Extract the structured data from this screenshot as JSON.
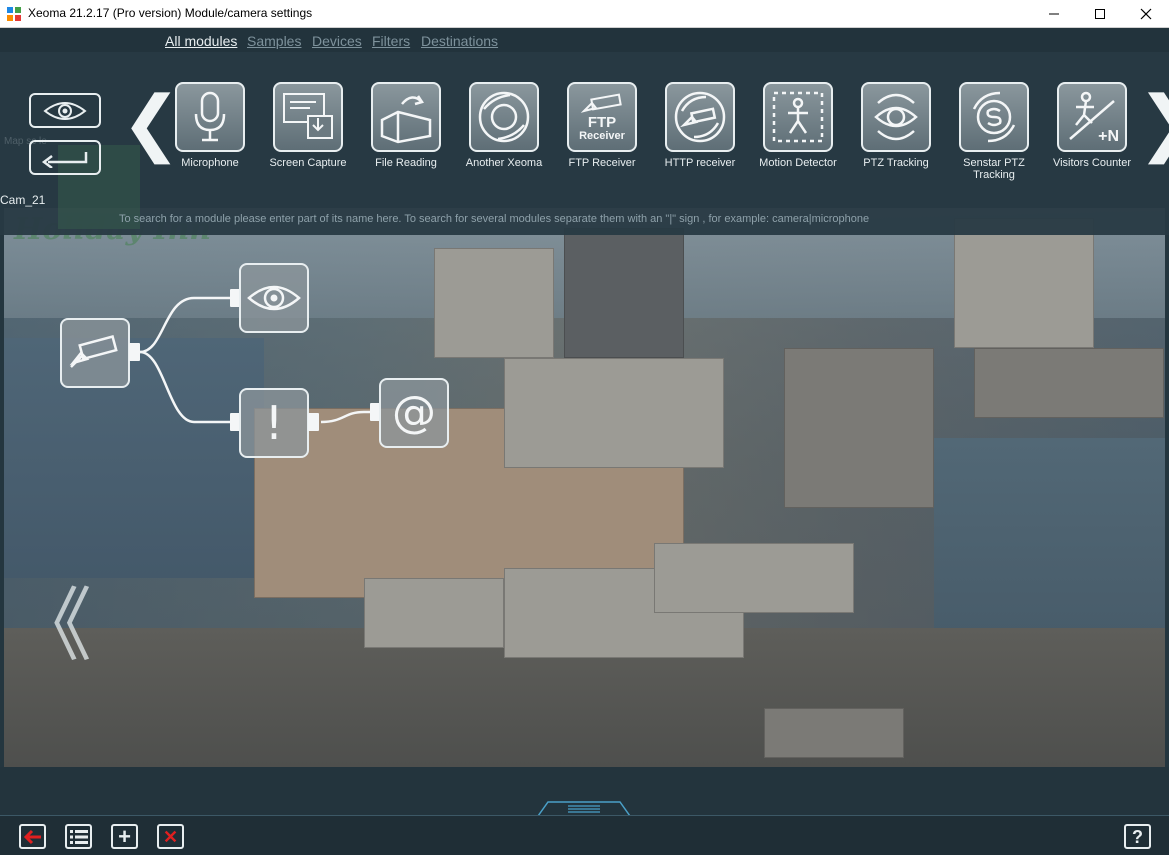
{
  "window": {
    "title": "Xeoma 21.2.17 (Pro version) Module/camera settings",
    "min_label": "—",
    "max_label": "☐",
    "close_label": "✕"
  },
  "tabs": [
    {
      "label": "All modules",
      "active": true
    },
    {
      "label": "Samples",
      "active": false
    },
    {
      "label": "Devices",
      "active": false
    },
    {
      "label": "Filters",
      "active": false
    },
    {
      "label": "Destinations",
      "active": false
    }
  ],
  "camera_label": "Cam_21",
  "faint_text": "Map sc le",
  "canvas_logo": "Holiday Inn",
  "modules": [
    {
      "label": "Microphone",
      "icon": "microphone-icon"
    },
    {
      "label": "Screen Capture",
      "icon": "screen-capture-icon"
    },
    {
      "label": "File Reading",
      "icon": "file-reading-icon"
    },
    {
      "label": "Another Xeoma",
      "icon": "another-xeoma-icon"
    },
    {
      "label": "FTP Receiver",
      "icon": "ftp-receiver-icon",
      "icon_text_1": "FTP",
      "icon_text_2": "Receiver"
    },
    {
      "label": "HTTP receiver",
      "icon": "http-receiver-icon"
    },
    {
      "label": "Motion Detector",
      "icon": "motion-detector-icon"
    },
    {
      "label": "PTZ Tracking",
      "icon": "ptz-tracking-icon"
    },
    {
      "label": "Senstar PTZ Tracking",
      "icon": "senstar-ptz-icon"
    },
    {
      "label": "Visitors Counter",
      "icon": "visitors-counter-icon",
      "icon_text_1": "+N"
    }
  ],
  "search_hint": "To search for a module please enter part of its name here. To search for several modules separate them with an \"|\" sign , for example: camera|microphone",
  "arrows": {
    "left": "❮",
    "right": "❯",
    "canvas_left": "《"
  },
  "chain": {
    "email_symbol": "@",
    "alert_symbol": "!"
  },
  "bottom": {
    "help_label": "?",
    "add_label": "+",
    "delete_label": "✕"
  },
  "colors": {
    "accent": "#e8eef0",
    "panel": "#24363f",
    "back_arrow": "#e02020",
    "delete": "#e02020"
  }
}
